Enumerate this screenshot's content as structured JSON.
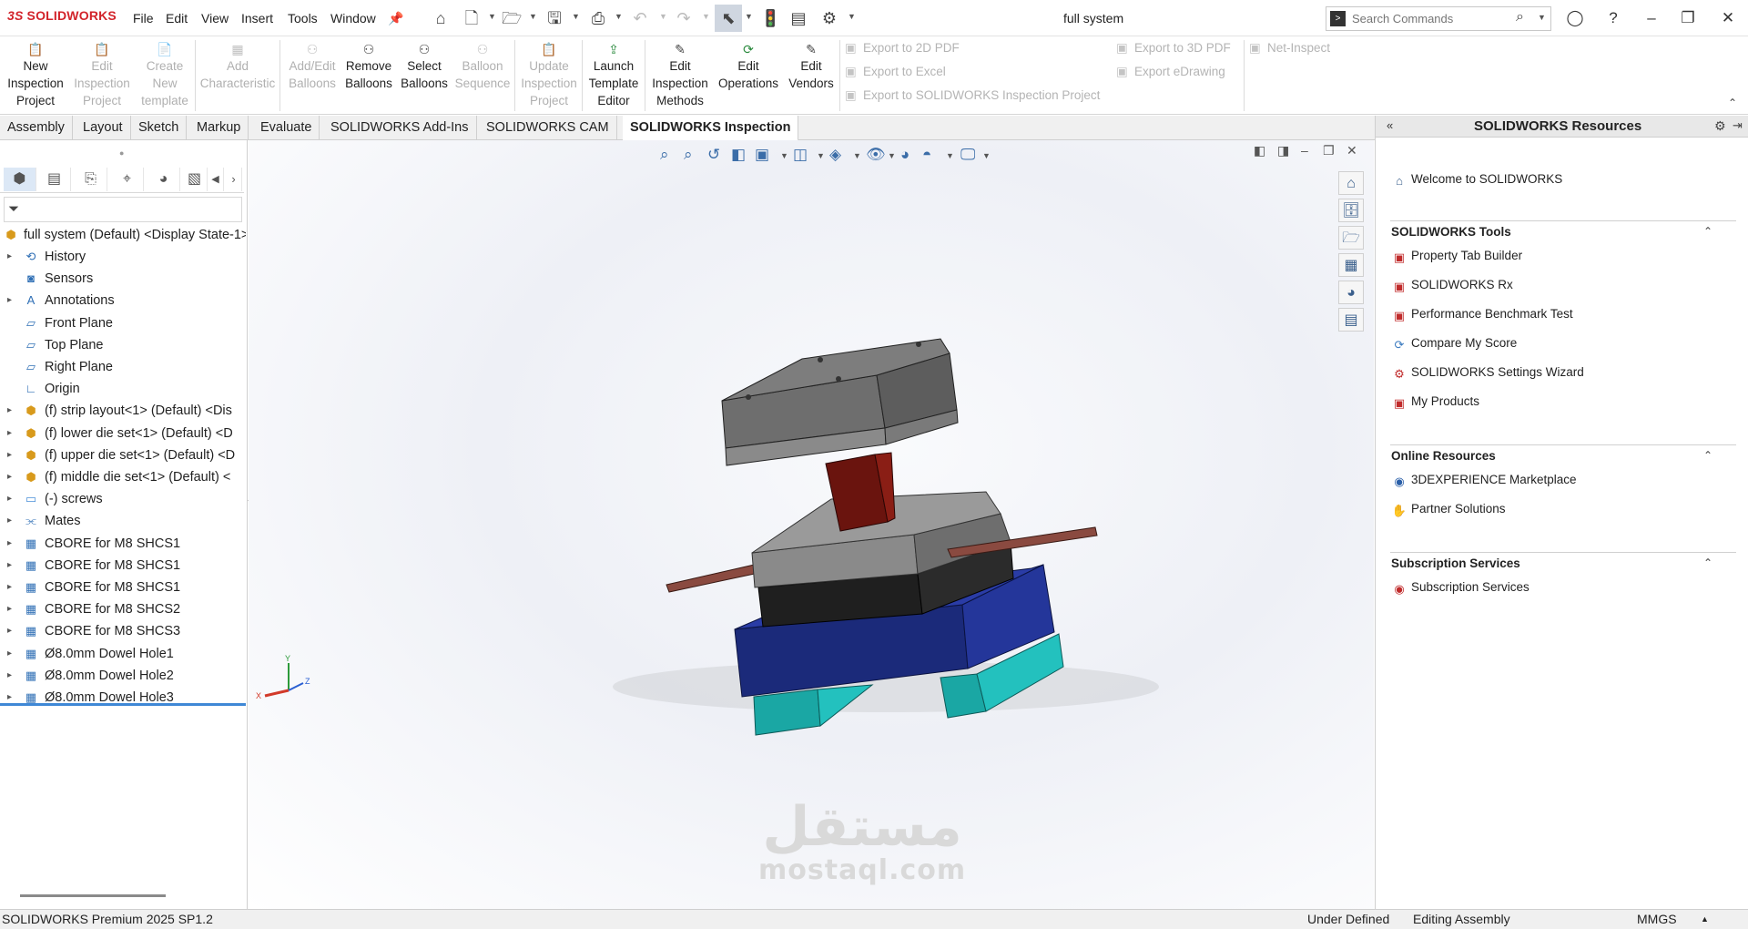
{
  "app": {
    "brand": "SOLIDWORKS",
    "brand_prefix": "3S",
    "document_title": "full system"
  },
  "menu": [
    "File",
    "Edit",
    "View",
    "Insert",
    "Tools",
    "Window"
  ],
  "search": {
    "placeholder": "Search Commands"
  },
  "ribbon": {
    "buttons": [
      {
        "label": "New Inspection Project",
        "enabled": true
      },
      {
        "label": "Edit Inspection Project",
        "enabled": false
      },
      {
        "label": "Create New template",
        "enabled": false
      },
      {
        "label": "Add Characteristic",
        "enabled": false
      },
      {
        "label": "Add/Edit Balloons",
        "enabled": false
      },
      {
        "label": "Remove Balloons",
        "enabled": true
      },
      {
        "label": "Select Balloons",
        "enabled": true
      },
      {
        "label": "Balloon Sequence",
        "enabled": false
      },
      {
        "label": "Update Inspection Project",
        "enabled": false
      },
      {
        "label": "Launch Template Editor",
        "enabled": true
      },
      {
        "label": "Edit Inspection Methods",
        "enabled": true
      },
      {
        "label": "Edit Operations",
        "enabled": true
      },
      {
        "label": "Edit Vendors",
        "enabled": true
      }
    ],
    "exports": [
      "Export to 2D PDF",
      "Export to Excel",
      "Export to SOLIDWORKS Inspection Project",
      "Export to 3D PDF",
      "Export eDrawing",
      "Net-Inspect"
    ]
  },
  "tabs": [
    "Assembly",
    "Layout",
    "Sketch",
    "Markup",
    "Evaluate",
    "SOLIDWORKS Add-Ins",
    "SOLIDWORKS CAM",
    "SOLIDWORKS Inspection"
  ],
  "active_tab": "SOLIDWORKS Inspection",
  "tree": {
    "root": "full system (Default) <Display State-1>",
    "items": [
      {
        "label": "History",
        "icon": "history-icon",
        "expandable": true
      },
      {
        "label": "Sensors",
        "icon": "sensor-icon",
        "expandable": false
      },
      {
        "label": "Annotations",
        "icon": "annotation-icon",
        "expandable": true
      },
      {
        "label": "Front Plane",
        "icon": "plane-icon",
        "expandable": false
      },
      {
        "label": "Top Plane",
        "icon": "plane-icon",
        "expandable": false
      },
      {
        "label": "Right Plane",
        "icon": "plane-icon",
        "expandable": false
      },
      {
        "label": "Origin",
        "icon": "origin-icon",
        "expandable": false
      },
      {
        "label": "(f) strip layout<1> (Default) <Dis",
        "icon": "assembly-icon",
        "expandable": true
      },
      {
        "label": "(f) lower die set<1> (Default) <D",
        "icon": "assembly-icon",
        "expandable": true
      },
      {
        "label": "(f) upper die set<1> (Default) <D",
        "icon": "assembly-icon",
        "expandable": true
      },
      {
        "label": "(f) middle die set<1> (Default) <",
        "icon": "assembly-icon",
        "expandable": true
      },
      {
        "label": "(-) screws",
        "icon": "folder-icon",
        "expandable": true
      },
      {
        "label": "Mates",
        "icon": "mates-icon",
        "expandable": true
      },
      {
        "label": "CBORE for M8 SHCS1",
        "icon": "hole-icon",
        "expandable": true
      },
      {
        "label": "CBORE for M8 SHCS1",
        "icon": "hole-icon",
        "expandable": true
      },
      {
        "label": "CBORE for M8 SHCS1",
        "icon": "hole-icon",
        "expandable": true
      },
      {
        "label": "CBORE for M8 SHCS2",
        "icon": "hole-icon",
        "expandable": true
      },
      {
        "label": "CBORE for M8 SHCS3",
        "icon": "hole-icon",
        "expandable": true
      },
      {
        "label": "Ø8.0mm Dowel Hole1",
        "icon": "hole-icon",
        "expandable": true
      },
      {
        "label": "Ø8.0mm Dowel Hole2",
        "icon": "hole-icon",
        "expandable": true
      },
      {
        "label": "Ø8.0mm Dowel Hole3",
        "icon": "hole-icon",
        "expandable": true
      }
    ]
  },
  "viewport": {
    "triad": {
      "x": "X",
      "y": "Y",
      "z": "Z"
    },
    "watermark": {
      "arabic": "مستقل",
      "latin": "mostaql.com"
    },
    "colors": {
      "top_plate": "#6d6d6d",
      "middle_plate": "#7a7a7a",
      "black_plate": "#222222",
      "blue_base": "#1b2a7a",
      "teal_feet": "#1aa7a4",
      "punch": "#7a1a12"
    }
  },
  "taskpane": {
    "title": "SOLIDWORKS Resources",
    "welcome": "Welcome to SOLIDWORKS",
    "sections": [
      {
        "title": "SOLIDWORKS Tools",
        "items": [
          "Property Tab Builder",
          "SOLIDWORKS Rx",
          "Performance Benchmark Test",
          "Compare My Score",
          "SOLIDWORKS Settings Wizard",
          "My Products"
        ]
      },
      {
        "title": "Online Resources",
        "items": [
          "3DEXPERIENCE Marketplace",
          "Partner Solutions"
        ]
      },
      {
        "title": "Subscription Services",
        "items": [
          "Subscription Services"
        ]
      }
    ]
  },
  "status": {
    "version": "SOLIDWORKS Premium 2025 SP1.2",
    "state": "Under Defined",
    "mode": "Editing Assembly",
    "units": "MMGS"
  }
}
